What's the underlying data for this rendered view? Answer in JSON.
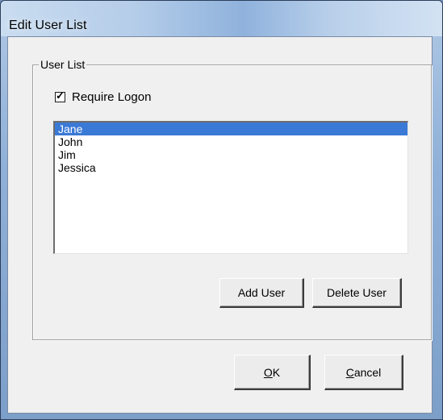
{
  "window": {
    "title": "Edit User List"
  },
  "group": {
    "label": "User List",
    "require_logon": {
      "label": "Require Logon",
      "checked": true
    }
  },
  "users": [
    "Jane",
    "John",
    "Jim",
    "Jessica"
  ],
  "selected_user": "Jane",
  "buttons": {
    "add_user": "Add User",
    "delete_user": "Delete User",
    "ok_mnemonic": "O",
    "ok_rest": "K",
    "cancel_mnemonic": "C",
    "cancel_rest": "ancel"
  },
  "colors": {
    "selection": "#3a79d6",
    "dialog_bg": "#f0f0f0"
  }
}
